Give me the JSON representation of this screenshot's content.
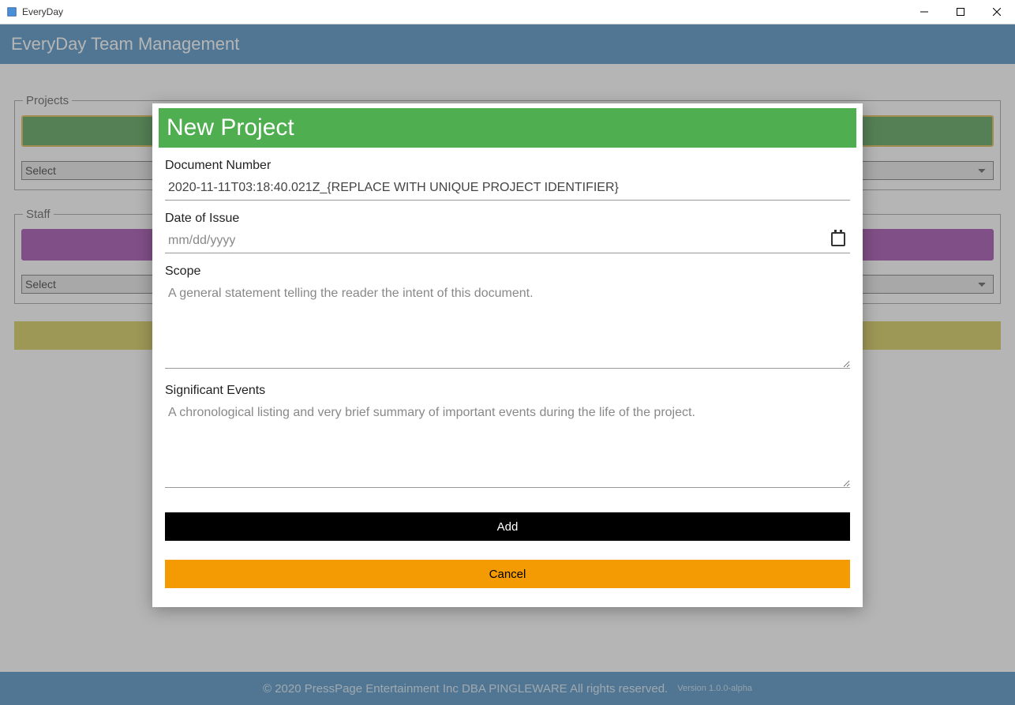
{
  "window": {
    "title": "EveryDay"
  },
  "header": {
    "title": "EveryDay Team Management"
  },
  "main": {
    "projects": {
      "legend": "Projects",
      "select_label": "Select"
    },
    "staff": {
      "legend": "Staff",
      "select_label": "Select"
    }
  },
  "footer": {
    "copyright": "© 2020 PressPage Entertainment Inc DBA PINGLEWARE  All rights reserved.",
    "version": "Version 1.0.0-alpha"
  },
  "modal": {
    "title": "New Project",
    "doc_num_label": "Document Number",
    "doc_num_value": "2020-11-11T03:18:40.021Z_{REPLACE WITH UNIQUE PROJECT IDENTIFIER}",
    "date_label": "Date of Issue",
    "date_placeholder": "mm/dd/yyyy",
    "scope_label": "Scope",
    "scope_placeholder": "A general statement telling the reader the intent of this document.",
    "events_label": "Significant Events",
    "events_placeholder": "A chronological listing and very brief summary of important events during the life of the project.",
    "add_label": "Add",
    "cancel_label": "Cancel"
  }
}
